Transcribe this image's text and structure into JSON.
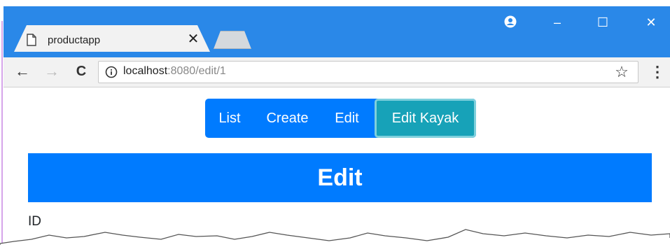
{
  "browser": {
    "tab": {
      "title": "productapp",
      "close_glyph": "✕"
    },
    "window_controls": {
      "minimize": "–",
      "maximize": "☐",
      "close": "✕"
    },
    "nav": {
      "back": "←",
      "forward": "→",
      "reload": "C"
    },
    "address": {
      "host": "localhost",
      "path": ":8080/edit/1"
    },
    "star_glyph": "☆",
    "menu_glyph": "⋮"
  },
  "app": {
    "nav_buttons": [
      "List",
      "Create",
      "Edit",
      "Edit Kayak"
    ],
    "active_button": "Edit Kayak",
    "heading": "Edit",
    "first_field_label": "ID"
  },
  "colors": {
    "titlebar": "#2a88e8",
    "primary": "#007bff",
    "active_info": "#17a2b8"
  }
}
